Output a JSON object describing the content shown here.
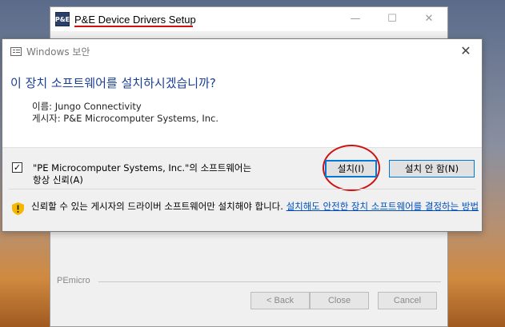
{
  "setup": {
    "title": "P&E Device Drivers Setup",
    "logo": "P&E",
    "minimize_icon": "—",
    "maximize_icon": "☐",
    "close_icon": "✕",
    "footer_label": "PEmicro",
    "back_label": "< Back",
    "close_label": "Close",
    "cancel_label": "Cancel"
  },
  "dialog": {
    "title": "Windows 보안",
    "close_icon": "✕",
    "heading": "이 장치 소프트웨어를 설치하시겠습니까?",
    "name_line": "이름: Jungo Connectivity",
    "publisher_line": "게시자: P&E Microcomputer Systems, Inc.",
    "checkbox_checked": "✓",
    "checkbox_label": "\"PE Microcomputer Systems, Inc.\"의 소프트웨어는 항상 신뢰(A)",
    "install_label": "설치(I)",
    "no_install_label": "설치 안 함(N)",
    "warning_text": "신뢰할 수 있는 게시자의 드라이버 소프트웨어만 설치해야 합니다.",
    "warning_link": "설치해도 안전한 장치 소프트웨어를 결정하는 방법"
  },
  "colors": {
    "heading": "#1a3f9a",
    "link": "#0050c0",
    "highlight": "#d01010",
    "accent": "#0078d7"
  }
}
